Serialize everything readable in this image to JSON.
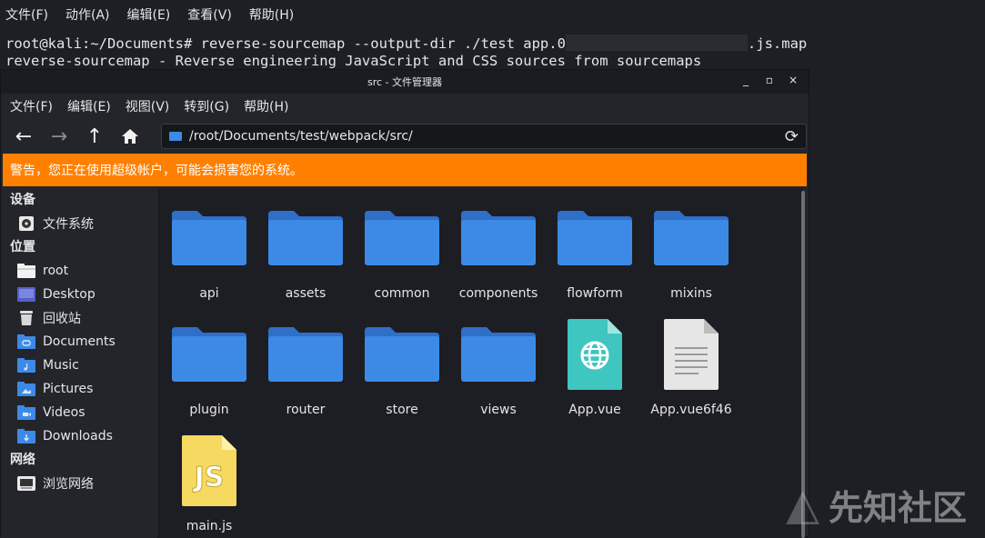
{
  "terminal": {
    "menu": [
      "文件(F)",
      "动作(A)",
      "编辑(E)",
      "查看(V)",
      "帮助(H)"
    ],
    "line1_prefix": "root@kali:~/Documents# reverse-sourcemap --output-dir ./test app.0",
    "line1_suffix": ".js.map",
    "line2": "reverse-sourcemap - Reverse engineering JavaScript and CSS sources from sourcemaps"
  },
  "window": {
    "title": "src - 文件管理器",
    "controls": [
      "_",
      "▫",
      "×"
    ],
    "menu": [
      "文件(F)",
      "编辑(E)",
      "视图(V)",
      "转到(G)",
      "帮助(H)"
    ],
    "path": "/root/Documents/test/webpack/src/",
    "warning": "警告，您正在使用超级帐户，可能会损害您的系统。"
  },
  "sidebar": {
    "devices_header": "设备",
    "devices": [
      {
        "label": "文件系统",
        "icon": "drive-icon"
      }
    ],
    "places_header": "位置",
    "places": [
      {
        "label": "root",
        "icon": "home-folder-icon"
      },
      {
        "label": "Desktop",
        "icon": "desktop-folder-icon"
      },
      {
        "label": "回收站",
        "icon": "trash-icon"
      },
      {
        "label": "Documents",
        "icon": "documents-folder-icon"
      },
      {
        "label": "Music",
        "icon": "music-folder-icon"
      },
      {
        "label": "Pictures",
        "icon": "pictures-folder-icon"
      },
      {
        "label": "Videos",
        "icon": "videos-folder-icon"
      },
      {
        "label": "Downloads",
        "icon": "downloads-folder-icon"
      }
    ],
    "network_header": "网络",
    "network": [
      {
        "label": "浏览网络",
        "icon": "network-icon"
      }
    ]
  },
  "files": [
    {
      "name": "api",
      "type": "folder"
    },
    {
      "name": "assets",
      "type": "folder"
    },
    {
      "name": "common",
      "type": "folder"
    },
    {
      "name": "components",
      "type": "folder"
    },
    {
      "name": "flowform",
      "type": "folder"
    },
    {
      "name": "mixins",
      "type": "folder"
    },
    {
      "name": "plugin",
      "type": "folder"
    },
    {
      "name": "router",
      "type": "folder"
    },
    {
      "name": "store",
      "type": "folder"
    },
    {
      "name": "views",
      "type": "folder"
    },
    {
      "name": "App.vue",
      "type": "vue"
    },
    {
      "name": "App.vue6f46",
      "type": "text"
    },
    {
      "name": "main.js",
      "type": "js"
    }
  ],
  "watermark": "先知社区",
  "colors": {
    "warning": "#ff8000",
    "folder": "#3d8ae6",
    "vue": "#3fc6c0",
    "js": "#f5d960"
  }
}
